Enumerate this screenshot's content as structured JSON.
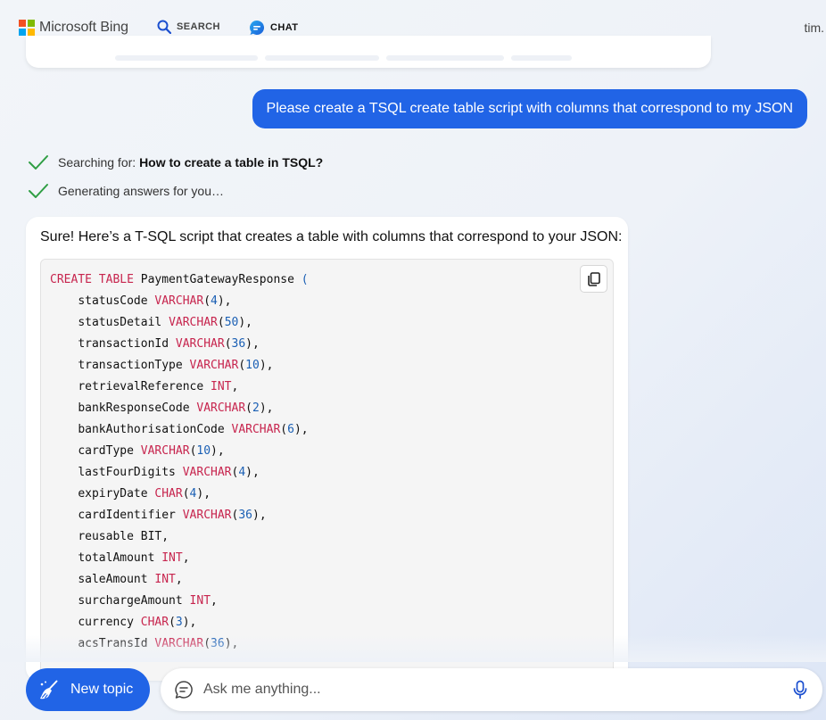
{
  "header": {
    "logo_text": "Microsoft Bing",
    "nav": {
      "search_label": "SEARCH",
      "chat_label": "CHAT"
    },
    "user_name": "tim."
  },
  "colors": {
    "accent": "#2164e6",
    "keyword": "#c7254e",
    "number": "#1a5fb4",
    "check": "#2f9e44"
  },
  "conversation": {
    "user_message": "Please create a TSQL create table script with columns that correspond to my JSON",
    "status": {
      "searching_prefix": "Searching for: ",
      "searching_query": "How to create a table in TSQL?",
      "generating": "Generating answers for you…"
    },
    "answer_intro": "Sure! Here’s a T-SQL script that creates a table with columns that correspond to your JSON:",
    "code_lines": [
      {
        "indent": "",
        "parts": [
          {
            "t": "CREATE TABLE",
            "c": "kw"
          },
          {
            "t": " PaymentGatewayResponse "
          },
          {
            "t": "(",
            "c": "num"
          }
        ]
      },
      {
        "indent": "    ",
        "parts": [
          {
            "t": "statusCode "
          },
          {
            "t": "VARCHAR",
            "c": "kw"
          },
          {
            "t": "("
          },
          {
            "t": "4",
            "c": "num"
          },
          {
            "t": "),"
          }
        ]
      },
      {
        "indent": "    ",
        "parts": [
          {
            "t": "statusDetail "
          },
          {
            "t": "VARCHAR",
            "c": "kw"
          },
          {
            "t": "("
          },
          {
            "t": "50",
            "c": "num"
          },
          {
            "t": "),"
          }
        ]
      },
      {
        "indent": "    ",
        "parts": [
          {
            "t": "transactionId "
          },
          {
            "t": "VARCHAR",
            "c": "kw"
          },
          {
            "t": "("
          },
          {
            "t": "36",
            "c": "num"
          },
          {
            "t": "),"
          }
        ]
      },
      {
        "indent": "    ",
        "parts": [
          {
            "t": "transactionType "
          },
          {
            "t": "VARCHAR",
            "c": "kw"
          },
          {
            "t": "("
          },
          {
            "t": "10",
            "c": "num"
          },
          {
            "t": "),"
          }
        ]
      },
      {
        "indent": "    ",
        "parts": [
          {
            "t": "retrievalReference "
          },
          {
            "t": "INT",
            "c": "kw"
          },
          {
            "t": ","
          }
        ]
      },
      {
        "indent": "    ",
        "parts": [
          {
            "t": "bankResponseCode "
          },
          {
            "t": "VARCHAR",
            "c": "kw"
          },
          {
            "t": "("
          },
          {
            "t": "2",
            "c": "num"
          },
          {
            "t": "),"
          }
        ]
      },
      {
        "indent": "    ",
        "parts": [
          {
            "t": "bankAuthorisationCode "
          },
          {
            "t": "VARCHAR",
            "c": "kw"
          },
          {
            "t": "("
          },
          {
            "t": "6",
            "c": "num"
          },
          {
            "t": "),"
          }
        ]
      },
      {
        "indent": "    ",
        "parts": [
          {
            "t": "cardType "
          },
          {
            "t": "VARCHAR",
            "c": "kw"
          },
          {
            "t": "("
          },
          {
            "t": "10",
            "c": "num"
          },
          {
            "t": "),"
          }
        ]
      },
      {
        "indent": "    ",
        "parts": [
          {
            "t": "lastFourDigits "
          },
          {
            "t": "VARCHAR",
            "c": "kw"
          },
          {
            "t": "("
          },
          {
            "t": "4",
            "c": "num"
          },
          {
            "t": "),"
          }
        ]
      },
      {
        "indent": "    ",
        "parts": [
          {
            "t": "expiryDate "
          },
          {
            "t": "CHAR",
            "c": "kw"
          },
          {
            "t": "("
          },
          {
            "t": "4",
            "c": "num"
          },
          {
            "t": "),"
          }
        ]
      },
      {
        "indent": "    ",
        "parts": [
          {
            "t": "cardIdentifier "
          },
          {
            "t": "VARCHAR",
            "c": "kw"
          },
          {
            "t": "("
          },
          {
            "t": "36",
            "c": "num"
          },
          {
            "t": "),"
          }
        ]
      },
      {
        "indent": "    ",
        "parts": [
          {
            "t": "reusable BIT,"
          }
        ]
      },
      {
        "indent": "    ",
        "parts": [
          {
            "t": "totalAmount "
          },
          {
            "t": "INT",
            "c": "kw"
          },
          {
            "t": ","
          }
        ]
      },
      {
        "indent": "    ",
        "parts": [
          {
            "t": "saleAmount "
          },
          {
            "t": "INT",
            "c": "kw"
          },
          {
            "t": ","
          }
        ]
      },
      {
        "indent": "    ",
        "parts": [
          {
            "t": "surchargeAmount "
          },
          {
            "t": "INT",
            "c": "kw"
          },
          {
            "t": ","
          }
        ]
      },
      {
        "indent": "    ",
        "parts": [
          {
            "t": "currency "
          },
          {
            "t": "CHAR",
            "c": "kw"
          },
          {
            "t": "("
          },
          {
            "t": "3",
            "c": "num"
          },
          {
            "t": "),"
          }
        ]
      },
      {
        "indent": "    ",
        "parts": [
          {
            "t": "acsTransId "
          },
          {
            "t": "VARCHAR",
            "c": "kw"
          },
          {
            "t": "("
          },
          {
            "t": "36",
            "c": "num"
          },
          {
            "t": "),"
          }
        ]
      }
    ]
  },
  "bottom_bar": {
    "new_topic_label": "New topic",
    "ask_placeholder": "Ask me anything..."
  },
  "icons": {
    "search": "search-icon",
    "chat": "chat-icon",
    "check": "check-icon",
    "copy": "copy-icon",
    "broom": "broom-icon",
    "ask": "chat-bubble-icon",
    "mic": "microphone-icon"
  }
}
